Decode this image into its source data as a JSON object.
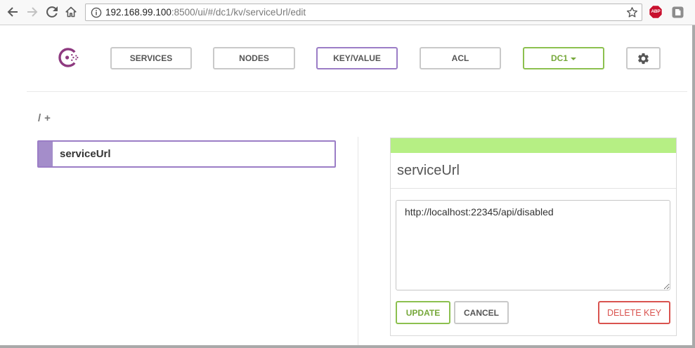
{
  "browser": {
    "url_host": "192.168.99.100",
    "url_rest": ":8500/ui/#/dc1/kv/serviceUrl/edit",
    "extension_badge": "ABP",
    "icons": [
      "back-arrow-icon",
      "forward-arrow-icon",
      "reload-icon",
      "home-icon",
      "info-icon",
      "bookmark-star-icon",
      "adblock-plus-icon",
      "extension-icon"
    ]
  },
  "nav": {
    "items": [
      {
        "label": "SERVICES",
        "active": false
      },
      {
        "label": "NODES",
        "active": false
      },
      {
        "label": "KEY/VALUE",
        "active": true
      },
      {
        "label": "ACL",
        "active": false
      }
    ],
    "datacenter": "DC1",
    "icons": [
      "consul-logo-icon",
      "caret-down-icon",
      "gear-icon"
    ]
  },
  "kv": {
    "breadcrumb_root": "/",
    "breadcrumb_add": "+",
    "keys": [
      {
        "label": "serviceUrl",
        "selected": true
      }
    ],
    "editor": {
      "title": "serviceUrl",
      "value": "http://localhost:22345/api/disabled",
      "update_label": "UPDATE",
      "cancel_label": "CANCEL",
      "delete_label": "DELETE KEY"
    }
  },
  "colors": {
    "purple": "#9b7dc6",
    "purple-fill": "#a48dca",
    "green": "#8cc04f",
    "green-text": "#76a83a",
    "bar-green": "#b6ef84",
    "red": "#d9534f",
    "logo": "#8e3a80"
  }
}
